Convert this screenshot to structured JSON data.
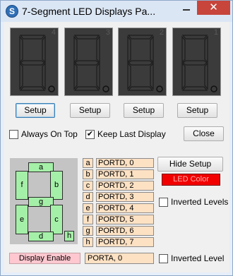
{
  "window": {
    "title": "7-Segment LED Displays Pa...",
    "close_glyph": "✕"
  },
  "digits": [
    {
      "number": "4"
    },
    {
      "number": "3"
    },
    {
      "number": "2"
    },
    {
      "number": "1"
    }
  ],
  "setup_buttons": [
    "Setup",
    "Setup",
    "Setup",
    "Setup"
  ],
  "options": {
    "always_on_top": {
      "label": "Always On Top",
      "checked": false
    },
    "keep_last_display": {
      "label": "Keep Last Display",
      "checked": true,
      "check_mark": "✔"
    }
  },
  "close_button": "Close",
  "segments": {
    "a": "a",
    "b": "b",
    "c": "c",
    "d": "d",
    "e": "e",
    "f": "f",
    "g": "g",
    "h": "h"
  },
  "pins": [
    {
      "letter": "a",
      "value": "PORTD, 0"
    },
    {
      "letter": "b",
      "value": "PORTD, 1"
    },
    {
      "letter": "c",
      "value": "PORTD, 2"
    },
    {
      "letter": "d",
      "value": "PORTD, 3"
    },
    {
      "letter": "e",
      "value": "PORTD, 4"
    },
    {
      "letter": "f",
      "value": "PORTD, 5"
    },
    {
      "letter": "g",
      "value": "PORTD, 6"
    },
    {
      "letter": "h",
      "value": "PORTD, 7"
    }
  ],
  "hide_setup_button": "Hide Setup",
  "led_color": {
    "label": "LED Color",
    "color": "#f20000"
  },
  "inverted_levels": {
    "label": "Inverted Levels",
    "checked": false
  },
  "display_enable": {
    "label": "Display Enable",
    "value": "PORTA, 0"
  },
  "inverted_level": {
    "label": "Inverted Level",
    "checked": false
  },
  "colors": {
    "segment_on": "#a5f0a8",
    "pin_bg": "#fde1c3",
    "display_bg": "#3b3b3b",
    "enable_bg": "#ffc8d0"
  }
}
